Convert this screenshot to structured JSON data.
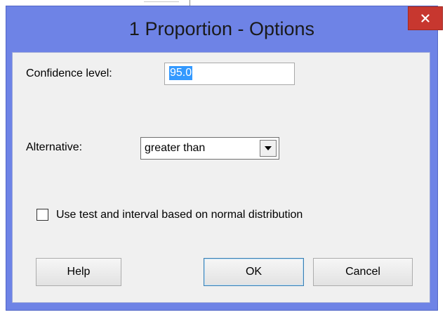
{
  "dialog": {
    "title": "1 Proportion - Options",
    "close_symbol": "×",
    "colors": {
      "titlebar": "#6e83e6",
      "close_button": "#c7372f",
      "client": "#f0f0f0",
      "selection": "#3399ff"
    }
  },
  "confidence": {
    "label": "Confidence level:",
    "value": "95.0"
  },
  "alternative": {
    "label": "Alternative:",
    "selected": "greater than",
    "arrow_icon": "chevron-down-icon"
  },
  "normal_distribution": {
    "label": "Use test and interval based on normal distribution",
    "checked": false
  },
  "buttons": {
    "help": "Help",
    "ok": "OK",
    "cancel": "Cancel"
  }
}
